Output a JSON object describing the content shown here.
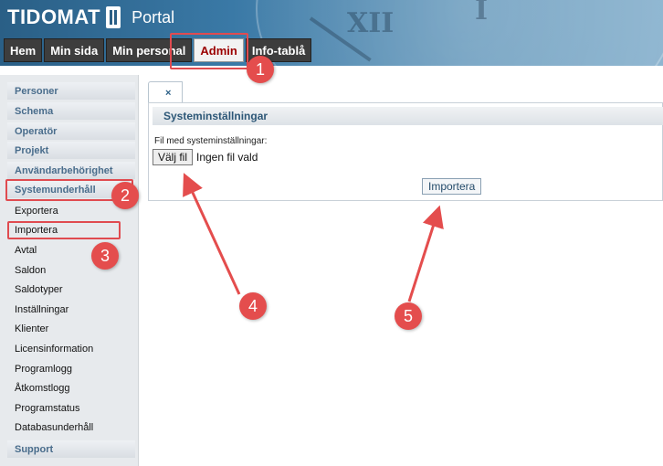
{
  "header": {
    "brand": "TIDOMAT",
    "portal": "Portal"
  },
  "tabs": [
    {
      "label": "Hem"
    },
    {
      "label": "Min sida"
    },
    {
      "label": "Min personal"
    },
    {
      "label": "Admin",
      "active": true
    },
    {
      "label": "Info-tablå"
    }
  ],
  "sidebar": {
    "sections": [
      {
        "label": "Personer"
      },
      {
        "label": "Schema"
      },
      {
        "label": "Operatör"
      },
      {
        "label": "Projekt"
      },
      {
        "label": "Användarbehörighet"
      },
      {
        "label": "Systemunderhåll"
      }
    ],
    "items": [
      {
        "label": "Exportera"
      },
      {
        "label": "Importera"
      },
      {
        "label": "Avtal"
      },
      {
        "label": "Saldon"
      },
      {
        "label": "Saldotyper"
      },
      {
        "label": "Inställningar"
      },
      {
        "label": "Klienter"
      },
      {
        "label": "Licensinformation"
      },
      {
        "label": "Programlogg"
      },
      {
        "label": "Åtkomstlogg"
      },
      {
        "label": "Programstatus"
      },
      {
        "label": "Databasunderhåll"
      }
    ],
    "footer": {
      "label": "Support"
    }
  },
  "main": {
    "tab_close": "×",
    "title": "Systeminställningar",
    "file_label": "Fil med systeminställningar:",
    "choose_file_button": "Välj fil",
    "file_status": "Ingen fil vald",
    "import_button": "Importera"
  },
  "annotations": [
    {
      "number": "1"
    },
    {
      "number": "2"
    },
    {
      "number": "3"
    },
    {
      "number": "4"
    },
    {
      "number": "5"
    }
  ],
  "colors": {
    "accent_red": "#e44d4d",
    "header_blue": "#2a5f86",
    "active_tab_text": "#9b0000"
  }
}
